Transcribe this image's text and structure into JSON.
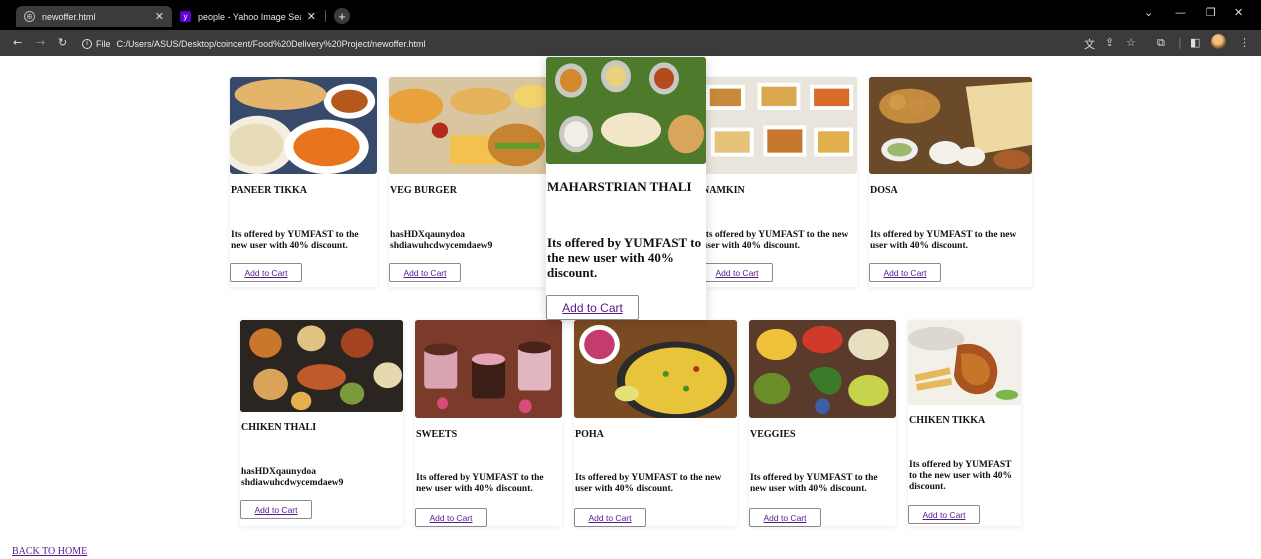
{
  "browser": {
    "tabs": [
      {
        "title": "newoffer.html",
        "active": true
      },
      {
        "title": "people - Yahoo Image Search R",
        "active": false
      }
    ],
    "url_scheme": "File",
    "url": "C:/Users/ASUS/Desktop/coincent/Food%20Delivery%20Project/newoffer.html",
    "icons": [
      "back-icon",
      "forward-icon",
      "reload-icon",
      "translate-icon",
      "share-icon",
      "star-icon",
      "extensions-icon",
      "sidepanel-icon",
      "profile-avatar",
      "menu-icon"
    ]
  },
  "colors": {
    "chrome_dark": "#000000",
    "chrome_toolbar": "#3b3b3b",
    "link": "#551a8b"
  },
  "button_label": "Add to Cart",
  "cards": [
    {
      "name": "PANEER TIKKA",
      "desc": "Its offered by YUMFAST to the new user with 40% discount.",
      "image": "paneer-tikka-photo"
    },
    {
      "name": "VEG BURGER",
      "desc": "hasHDXqaunydoa shdiawuhcdwycemdaew9",
      "image": "veg-burger-photo"
    },
    {
      "name": "MAHARSTRIAN THALI",
      "desc": "Its offered by YUMFAST to the new user with 40% discount.",
      "image": "maharashtrian-thali-photo",
      "hovered": true
    },
    {
      "name": "NAMKIN",
      "desc": "Its offered by YUMFAST to the new user with 40% discount.",
      "image": "namkin-photo"
    },
    {
      "name": "DOSA",
      "desc": "Its offered by YUMFAST to the new user with 40% discount.",
      "image": "dosa-photo"
    },
    {
      "name": "CHIKEN THALI",
      "desc": "hasHDXqaunydoa shdiawuhcdwycemdaew9",
      "image": "chiken-thali-photo"
    },
    {
      "name": "SWEETS",
      "desc": "Its offered by YUMFAST to the new user with 40% discount.",
      "image": "sweets-photo"
    },
    {
      "name": "POHA",
      "desc": "Its offered by YUMFAST to the new user with 40% discount.",
      "image": "poha-photo"
    },
    {
      "name": "VEGGIES",
      "desc": "Its offered by YUMFAST to the new user with 40% discount.",
      "image": "veggies-photo"
    },
    {
      "name": "CHIKEN TIKKA",
      "desc": "Its offered by YUMFAST to the new user with 40% discount.",
      "image": "chiken-tikka-photo"
    }
  ],
  "footer": {
    "home_link": "BACK TO HOME"
  }
}
